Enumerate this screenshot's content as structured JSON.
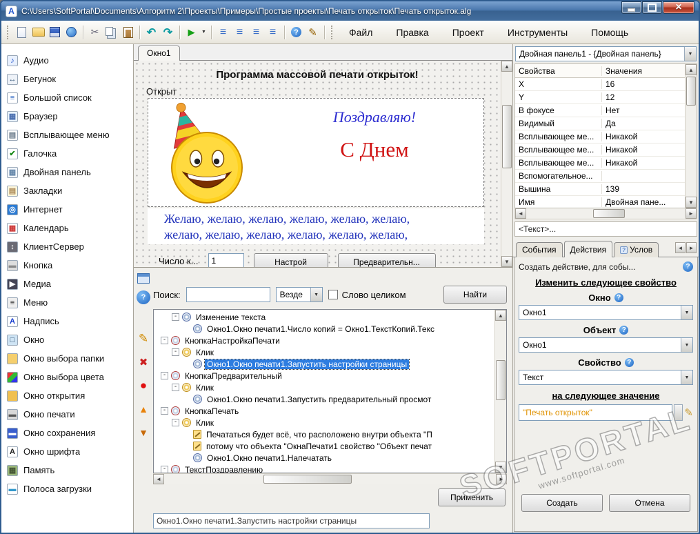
{
  "window": {
    "title": "C:\\Users\\SoftPortal\\Documents\\Алгоритм 2\\Проекты\\Примеры\\Простые проекты\\Печать открыток\\Печать открыток.alg"
  },
  "menu": [
    "Файл",
    "Правка",
    "Проект",
    "Инструменты",
    "Помощь"
  ],
  "toolbar_icons": [
    "new-doc",
    "open-folder",
    "save",
    "web-doc",
    "sep",
    "cut",
    "copy",
    "paste",
    "sep",
    "undo",
    "redo",
    "sep",
    "run",
    "run-menu",
    "sep",
    "list-blue-1",
    "list-blue-2",
    "list-blue-3",
    "list-blue-4",
    "sep",
    "help",
    "edit-tools",
    "sep"
  ],
  "sidebar": {
    "items": [
      {
        "label": "Аудио",
        "icon": "audio-icon",
        "glyph": "♪",
        "fg": "#2255cc",
        "bg": "#e8f0fe"
      },
      {
        "label": "Бегунок",
        "icon": "slider-icon",
        "glyph": "↔",
        "fg": "#335577",
        "bg": "#eef2f8"
      },
      {
        "label": "Большой список",
        "icon": "list-icon",
        "glyph": "≡",
        "fg": "#3a6fc8",
        "bg": "#ffffff"
      },
      {
        "label": "Браузер",
        "icon": "browser-icon",
        "glyph": "▦",
        "fg": "#4a6fb0",
        "bg": "#eaf4ff"
      },
      {
        "label": "Всплывающее меню",
        "icon": "popup-menu-icon",
        "glyph": "▤",
        "fg": "#667788",
        "bg": "#ffffff"
      },
      {
        "label": "Галочка",
        "icon": "checkbox-icon",
        "glyph": "✔",
        "fg": "#1a8a1a",
        "bg": "#ffffff"
      },
      {
        "label": "Двойная панель",
        "icon": "dual-panel-icon",
        "glyph": "▦",
        "fg": "#6688aa",
        "bg": "#f4f8ff"
      },
      {
        "label": "Закладки",
        "icon": "tabs-icon",
        "glyph": "▤",
        "fg": "#aa8855",
        "bg": "#fff8dd"
      },
      {
        "label": "Интернет",
        "icon": "internet-icon",
        "glyph": "◎",
        "fg": "#ffffff",
        "bg": "#2b7bd4"
      },
      {
        "label": "Календарь",
        "icon": "calendar-icon",
        "glyph": "▦",
        "fg": "#cc3333",
        "bg": "#ffffff"
      },
      {
        "label": "КлиентСервер",
        "icon": "client-server-icon",
        "glyph": "↕",
        "fg": "#ffffff",
        "bg": "#6a6a74"
      },
      {
        "label": "Кнопка",
        "icon": "button-icon",
        "glyph": "▬",
        "fg": "#888888",
        "bg": "#dddddd"
      },
      {
        "label": "Медиа",
        "icon": "media-icon",
        "glyph": "▶",
        "fg": "#ffffff",
        "bg": "#444455"
      },
      {
        "label": "Меню",
        "icon": "menu-icon",
        "glyph": "≡",
        "fg": "#333333",
        "bg": "#eeeeee"
      },
      {
        "label": "Надпись",
        "icon": "label-icon",
        "glyph": "A",
        "fg": "#1a3fd0",
        "bg": "#ffffff"
      },
      {
        "label": "Окно",
        "icon": "window-icon",
        "glyph": "□",
        "fg": "#224466",
        "bg": "#cfe4f4"
      },
      {
        "label": "Окно выбора папки",
        "icon": "folder-dialog-icon",
        "glyph": "",
        "fg": "#8a6a20",
        "bg": "#f5cf6e"
      },
      {
        "label": "Окно выбора цвета",
        "icon": "color-dialog-icon",
        "glyph": "",
        "fg": "#ffffff",
        "bg": "linear-gradient(135deg,#e33 33%,#3b3 33% 66%,#33e 66%)"
      },
      {
        "label": "Окно открытия",
        "icon": "open-dialog-icon",
        "glyph": "",
        "fg": "#8a6a20",
        "bg": "#f0c050"
      },
      {
        "label": "Окно печати",
        "icon": "print-dialog-icon",
        "glyph": "▬",
        "fg": "#555555",
        "bg": "#d8d8d8"
      },
      {
        "label": "Окно сохранения",
        "icon": "save-dialog-icon",
        "glyph": "▬",
        "fg": "#ffffff",
        "bg": "#3a5fcd"
      },
      {
        "label": "Окно шрифта",
        "icon": "font-dialog-icon",
        "glyph": "А",
        "fg": "#222222",
        "bg": "#ffffff"
      },
      {
        "label": "Память",
        "icon": "memory-icon",
        "glyph": "▦",
        "fg": "#445533",
        "bg": "#9ab87a"
      },
      {
        "label": "Полоса загрузки",
        "icon": "progress-bar-icon",
        "glyph": "▬",
        "fg": "#3399cc",
        "bg": "#ffffff"
      }
    ]
  },
  "strip_icons": [
    "panel-icon",
    "help-icon",
    "edit-pencil-icon",
    "delete-icon",
    "record-icon",
    "move-up-icon",
    "move-down-icon"
  ],
  "designer": {
    "tab": "Окно1",
    "form": {
      "title": "Программа массовой печати открыток!",
      "label_open": "Открыт",
      "greeting1": "Поздравляю!",
      "greeting2": "С Днем",
      "wish_line1": "Желаю, желаю, желаю, желаю, желаю, желаю,",
      "wish_line2": "желаю, желаю, желаю, желаю, желаю, желаю,",
      "copies_label": "Число к...",
      "copies_value": "1",
      "btn_settings": "Настрой",
      "btn_preview": "Предварительн..."
    }
  },
  "search": {
    "label": "Поиск:",
    "scope": "Везде",
    "whole_word": "Слово целиком",
    "find_button": "Найти"
  },
  "tree": {
    "items": [
      {
        "indent": 1,
        "expander": true,
        "icon": "action-gear",
        "label": "Изменение текста"
      },
      {
        "indent": 2,
        "expander": false,
        "icon": "gear",
        "label": "Окно1.Окно печати1.Число копий = Окно1.ТекстКопий.Текс"
      },
      {
        "indent": 0,
        "expander": true,
        "icon": "component",
        "label": "КнопкаНастройкаПечати"
      },
      {
        "indent": 1,
        "expander": true,
        "icon": "event",
        "label": "Клик"
      },
      {
        "indent": 2,
        "expander": false,
        "icon": "gear",
        "label": "Окно1.Окно печати1.Запустить настройки страницы",
        "selected": true
      },
      {
        "indent": 0,
        "expander": true,
        "icon": "component",
        "label": "КнопкаПредварительный"
      },
      {
        "indent": 1,
        "expander": true,
        "icon": "event",
        "label": "Клик"
      },
      {
        "indent": 2,
        "expander": false,
        "icon": "gear",
        "label": "Окно1.Окно печати1.Запустить предварительный просмот"
      },
      {
        "indent": 0,
        "expander": true,
        "icon": "component",
        "label": "КнопкаПечать"
      },
      {
        "indent": 1,
        "expander": true,
        "icon": "event",
        "label": "Клик"
      },
      {
        "indent": 2,
        "expander": false,
        "icon": "note",
        "label": "Печататься будет всё, что расположено внутри объекта \"П"
      },
      {
        "indent": 2,
        "expander": false,
        "icon": "note",
        "label": "потому что объекта \"ОкнаПечати1 свойство \"Объект печат"
      },
      {
        "indent": 2,
        "expander": false,
        "icon": "gear",
        "label": "Окно1.Окно печати1.Напечатать"
      },
      {
        "indent": 0,
        "expander": true,
        "icon": "component",
        "label": "ТекстПоздравлению"
      }
    ]
  },
  "apply": {
    "value": "Окно1.Окно печати1.Запустить настройки страницы",
    "button": "Применить"
  },
  "properties": {
    "selector": "Двойная панель1 - {Двойная панель}",
    "col_name": "Свойства",
    "col_value": "Значения",
    "rows": [
      {
        "name": "X",
        "value": "16"
      },
      {
        "name": "Y",
        "value": "12"
      },
      {
        "name": "В фокусе",
        "value": "Нет"
      },
      {
        "name": "Видимый",
        "value": "Да"
      },
      {
        "name": "Всплывающее ме...",
        "value": "Никакой"
      },
      {
        "name": "Всплывающее ме...",
        "value": "Никакой"
      },
      {
        "name": "Всплывающее ме...",
        "value": "Никакой"
      },
      {
        "name": "Вспомогательное...",
        "value": ""
      },
      {
        "name": "Вышина",
        "value": "139"
      },
      {
        "name": "Имя",
        "value": "Двойная пане..."
      }
    ],
    "text_row": "<Текст>..."
  },
  "action_panel": {
    "tabs": [
      "События",
      "Действия",
      "Услов"
    ],
    "active_tab": "Действия",
    "header": "Создать действие, для собы...",
    "section1": "Изменить следующее свойство",
    "window_label": "Окно",
    "window_value": "Окно1",
    "object_label": "Объект",
    "object_value": "Окно1",
    "property_label": "Свойство",
    "property_value": "Текст",
    "section2": "на следующее значение",
    "value_input": "\"Печать открыток\"",
    "create_button": "Создать",
    "cancel_button": "Отмена"
  },
  "watermark": {
    "text": "SOFTPORTAL",
    "url": "www.softportal.com"
  },
  "colors": {
    "selection": "#2e7de0",
    "accent_orange": "#e09200",
    "greeting_blue": "#2b2bd0",
    "greeting_red": "#d01414"
  }
}
